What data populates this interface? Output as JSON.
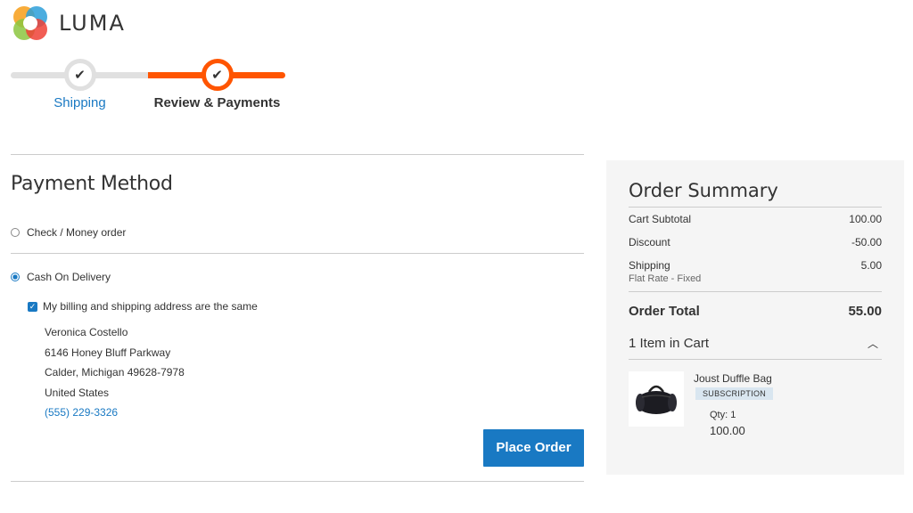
{
  "header": {
    "logo_text": "LUMA"
  },
  "progress": {
    "steps": [
      {
        "label": "Shipping",
        "state": "complete"
      },
      {
        "label": "Review & Payments",
        "state": "active"
      }
    ],
    "colors": {
      "active": "#ff5501",
      "complete": "#e0e0e0",
      "link": "#1979c3"
    }
  },
  "payment": {
    "title": "Payment Method",
    "methods": [
      {
        "label": "Check / Money order",
        "selected": false
      },
      {
        "label": "Cash On Delivery",
        "selected": true
      }
    ],
    "same_address_label": "My billing and shipping address are the same",
    "same_address_checked": true,
    "address": {
      "name": "Veronica Costello",
      "street": "6146 Honey Bluff Parkway",
      "city_line": "Calder, Michigan 49628-7978",
      "country": "United States",
      "phone": "(555) 229-3326"
    },
    "place_order_label": "Place Order"
  },
  "summary": {
    "title": "Order Summary",
    "cart_subtotal_label": "Cart Subtotal",
    "cart_subtotal_value": "100.00",
    "discount_label": "Discount",
    "discount_value": "-50.00",
    "shipping_label": "Shipping",
    "shipping_method": "Flat Rate - Fixed",
    "shipping_value": "5.00",
    "order_total_label": "Order Total",
    "order_total_value": "55.00",
    "items_in_cart": "1 Item in Cart",
    "items": [
      {
        "name": "Joust Duffle Bag",
        "badge": "SUBSCRIPTION",
        "qty": "Qty: 1",
        "price": "100.00"
      }
    ]
  }
}
